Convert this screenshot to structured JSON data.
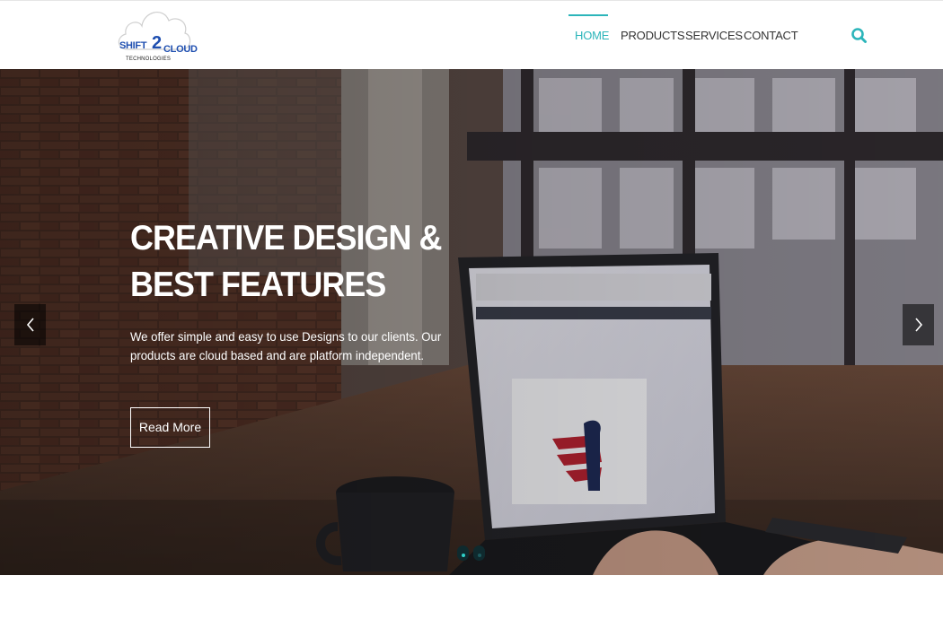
{
  "brand": {
    "logo_left": "SHIFT",
    "logo_digit": "2",
    "logo_right": "CLOUD",
    "logo_sub": "TECHNOLOGIES",
    "color": "#1f4fb0"
  },
  "nav": {
    "items": [
      {
        "label": "HOME",
        "active": true
      },
      {
        "label": "PRODUCTS",
        "active": false
      },
      {
        "label": "SERVICES",
        "active": false
      },
      {
        "label": "CONTACT",
        "active": false
      }
    ],
    "accent_color": "#2cb5ba",
    "search_icon": "search-icon"
  },
  "hero": {
    "title_line1": "CREATIVE DESIGN &",
    "title_line2": "BEST FEATURES",
    "description": "We offer simple and easy to use Designs to our clients. Our products are cloud based and are platform independent.",
    "cta_label": "Read More",
    "prev_icon": "chevron-left-icon",
    "next_icon": "chevron-right-icon",
    "slide_count": 2,
    "active_slide": 1
  }
}
